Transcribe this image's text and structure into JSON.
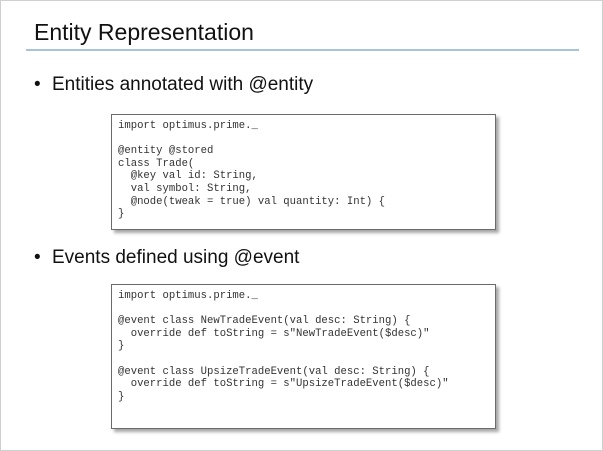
{
  "slide": {
    "title": "Entity Representation",
    "bullets": [
      {
        "marker": "•",
        "text": "Entities annotated with @entity",
        "code": [
          "import optimus.prime._",
          "",
          "@entity @stored",
          "class Trade(",
          "  @key val id: String,",
          "  val symbol: String,",
          "  @node(tweak = true) val quantity: Int) {",
          "}"
        ]
      },
      {
        "marker": "•",
        "text": "Events defined using @event",
        "code": [
          "import optimus.prime._",
          "",
          "@event class NewTradeEvent(val desc: String) {",
          "  override def toString = s\"NewTradeEvent($desc)\"",
          "}",
          "",
          "@event class UpsizeTradeEvent(val desc: String) {",
          "  override def toString = s\"UpsizeTradeEvent($desc)\"",
          "}"
        ]
      }
    ]
  }
}
